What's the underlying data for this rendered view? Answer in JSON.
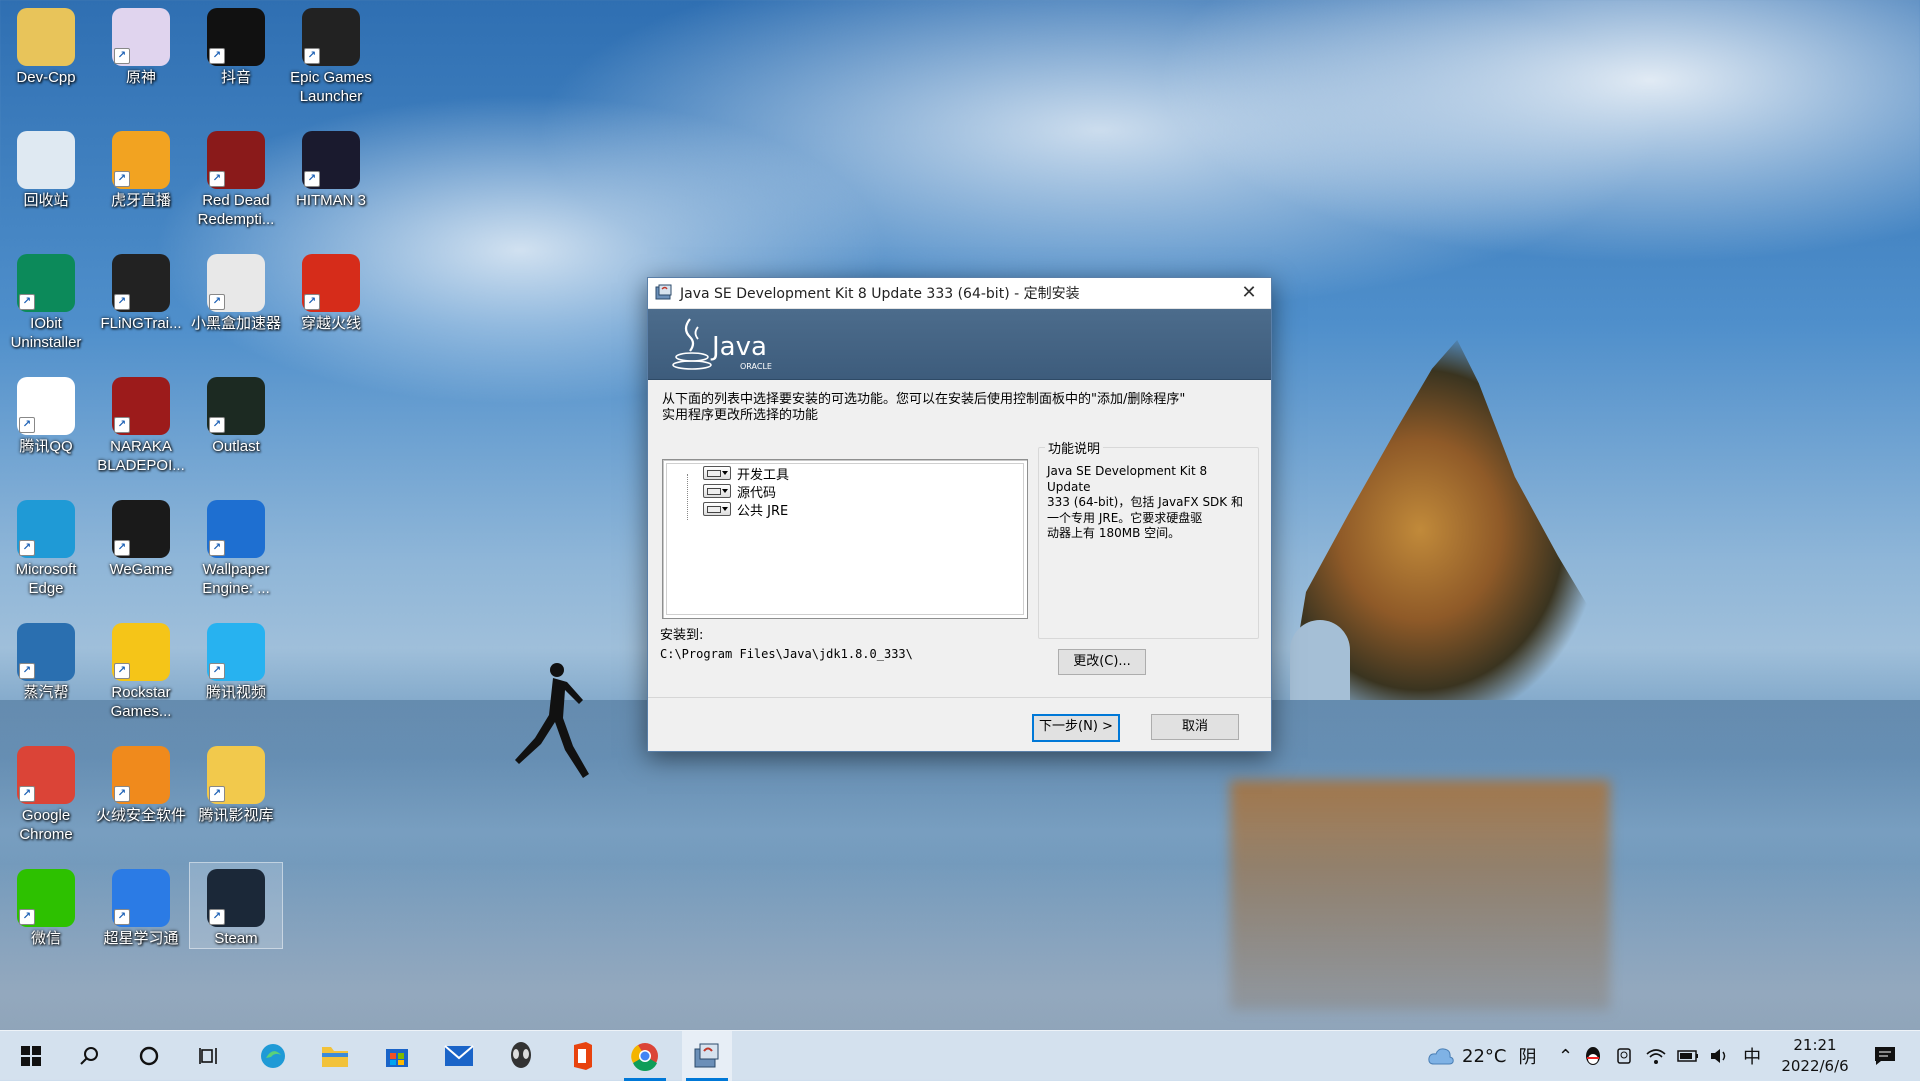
{
  "desktop": {
    "icons": [
      {
        "label": "Dev-Cpp",
        "icon": "folder-icon",
        "color": "#e8c45a"
      },
      {
        "label": "原神",
        "icon": "genshin-icon",
        "color": "#e0d4ee"
      },
      {
        "label": "抖音",
        "icon": "tiktok-icon",
        "color": "#111111"
      },
      {
        "label": "Epic Games Launcher",
        "icon": "epic-games-icon",
        "color": "#222222"
      },
      {
        "label": "回收站",
        "icon": "recycle-bin-icon",
        "color": "#dfe9f2"
      },
      {
        "label": "虎牙直播",
        "icon": "huya-icon",
        "color": "#f2a321"
      },
      {
        "label": "Red Dead Redempti...",
        "icon": "red-dead-icon",
        "color": "#8a1a1a"
      },
      {
        "label": "HITMAN 3",
        "icon": "hitman-icon",
        "color": "#1a1a2e"
      },
      {
        "label": "IObit Uninstaller",
        "icon": "iobit-icon",
        "color": "#0c8a5a"
      },
      {
        "label": "FLiNGTrai...",
        "icon": "fling-icon",
        "color": "#222222"
      },
      {
        "label": "小黑盒加速器",
        "icon": "xiaoheihe-icon",
        "color": "#e8e8e8"
      },
      {
        "label": "穿越火线",
        "icon": "crossfire-icon",
        "color": "#d62c1a"
      },
      {
        "label": "腾讯QQ",
        "icon": "qq-icon",
        "color": "#ffffff"
      },
      {
        "label": "NARAKA BLADEPOI...",
        "icon": "naraka-icon",
        "color": "#9c1b1b"
      },
      {
        "label": "Outlast",
        "icon": "outlast-icon",
        "color": "#1c2a22"
      },
      {
        "label": "Microsoft Edge",
        "icon": "edge-icon",
        "color": "#1f9ad6"
      },
      {
        "label": "WeGame",
        "icon": "wegame-icon",
        "color": "#1a1a1a"
      },
      {
        "label": "Wallpaper Engine: ...",
        "icon": "wallpaper-engine-icon",
        "color": "#1e6fd1"
      },
      {
        "label": "蒸汽帮",
        "icon": "steam-helper-icon",
        "color": "#2a6fb0"
      },
      {
        "label": "Rockstar Games...",
        "icon": "rockstar-icon",
        "color": "#f5c518"
      },
      {
        "label": "腾讯视频",
        "icon": "tencent-video-icon",
        "color": "#27b2f0"
      },
      {
        "label": "Google Chrome",
        "icon": "chrome-icon",
        "color": "#db4437"
      },
      {
        "label": "火绒安全软件",
        "icon": "huorong-icon",
        "color": "#f08a1c"
      },
      {
        "label": "腾讯影视库",
        "icon": "tencent-library-icon",
        "color": "#f2c94c"
      },
      {
        "label": "微信",
        "icon": "wechat-icon",
        "color": "#2dc100"
      },
      {
        "label": "超星学习通",
        "icon": "chaoxing-icon",
        "color": "#2b7be5"
      },
      {
        "label": "Steam",
        "icon": "steam-icon",
        "color": "#1b2838"
      }
    ]
  },
  "dialog": {
    "title": "Java SE Development Kit 8 Update 333 (64-bit) - 定制安装",
    "banner_logo": "Java",
    "banner_sub": "ORACLE",
    "instructions_line1": "从下面的列表中选择要安装的可选功能。您可以在安装后使用控制面板中的\"添加/删除程序\"",
    "instructions_line2": "实用程序更改所选择的功能",
    "features": [
      "开发工具",
      "源代码",
      "公共 JRE"
    ],
    "feature_panel_title": "功能说明",
    "feature_desc_lines": [
      "Java SE Development Kit 8 Update",
      "333 (64-bit)，包括 JavaFX SDK 和",
      "一个专用 JRE。它要求硬盘驱",
      "动器上有 180MB 空间。"
    ],
    "install_to_label": "安装到:",
    "install_path": "C:\\Program Files\\Java\\jdk1.8.0_333\\",
    "change_button": "更改(C)...",
    "next_button": "下一步(N) >",
    "cancel_button": "取消"
  },
  "taskbar": {
    "weather_temp": "22°C",
    "weather_cond": "阴",
    "ime": "中",
    "time": "21:21",
    "date": "2022/6/6",
    "colors": {
      "accent": "#0078d7"
    }
  }
}
